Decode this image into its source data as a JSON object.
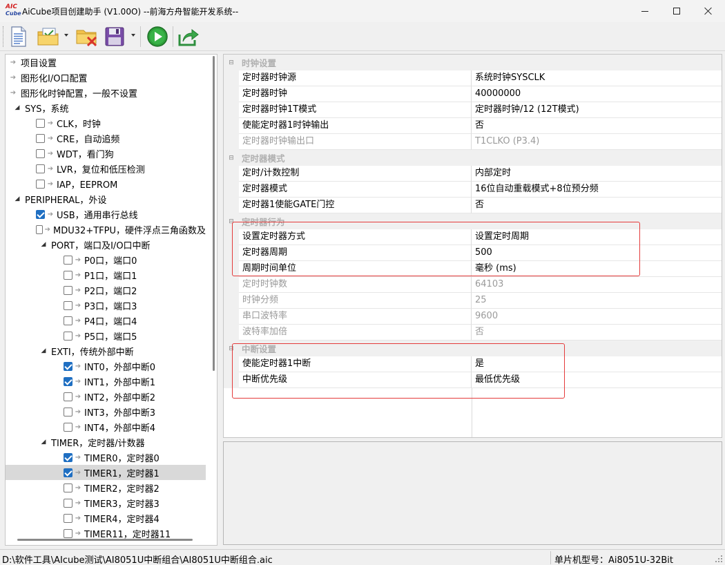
{
  "window": {
    "logo_top": "AIC",
    "logo_bottom": "Cube",
    "title": "AiCube项目创建助手 (V1.00O) --前海方舟智能开发系统--"
  },
  "toolbar": {
    "buttons": [
      {
        "name": "new-project",
        "icon": "new-document-icon"
      },
      {
        "name": "open-project",
        "icon": "open-folder-icon",
        "has_dropdown": true
      },
      {
        "name": "close-project",
        "icon": "close-folder-icon"
      },
      {
        "name": "save-project",
        "icon": "floppy-disk-icon",
        "has_dropdown": true
      },
      {
        "name": "run",
        "icon": "play-icon"
      },
      {
        "name": "export",
        "icon": "export-arrow-icon"
      }
    ]
  },
  "tree": {
    "items": [
      {
        "label": "项目设置",
        "kind": "leaf",
        "level": 0
      },
      {
        "label": "图形化I/O口配置",
        "kind": "leaf",
        "level": 0
      },
      {
        "label": "图形化时钟配置，一般不设置",
        "kind": "leaf",
        "level": 0
      },
      {
        "label": "SYS，系统",
        "kind": "group",
        "level": 0,
        "expanded": true
      },
      {
        "label": "CLK，时钟",
        "kind": "check",
        "level": 1,
        "checked": false
      },
      {
        "label": "CRE，自动追频",
        "kind": "check",
        "level": 1,
        "checked": false
      },
      {
        "label": "WDT，看门狗",
        "kind": "check",
        "level": 1,
        "checked": false
      },
      {
        "label": "LVR，复位和低压检测",
        "kind": "check",
        "level": 1,
        "checked": false
      },
      {
        "label": "IAP，EEPROM",
        "kind": "check",
        "level": 1,
        "checked": false
      },
      {
        "label": "PERIPHERAL，外设",
        "kind": "group",
        "level": 0,
        "expanded": true
      },
      {
        "label": "USB，通用串行总线",
        "kind": "check",
        "level": 1,
        "checked": true
      },
      {
        "label": "MDU32+TFPU，硬件浮点三角函数及",
        "kind": "check",
        "level": 1,
        "checked": false
      },
      {
        "label": "PORT，端口及I/O口中断",
        "kind": "group",
        "level": 1,
        "expanded": true
      },
      {
        "label": "P0口，端口0",
        "kind": "check",
        "level": 2,
        "checked": false
      },
      {
        "label": "P1口，端口1",
        "kind": "check",
        "level": 2,
        "checked": false
      },
      {
        "label": "P2口，端口2",
        "kind": "check",
        "level": 2,
        "checked": false
      },
      {
        "label": "P3口，端口3",
        "kind": "check",
        "level": 2,
        "checked": false
      },
      {
        "label": "P4口，端口4",
        "kind": "check",
        "level": 2,
        "checked": false
      },
      {
        "label": "P5口，端口5",
        "kind": "check",
        "level": 2,
        "checked": false
      },
      {
        "label": "EXTI，传统外部中断",
        "kind": "group",
        "level": 1,
        "expanded": true
      },
      {
        "label": "INT0，外部中断0",
        "kind": "check",
        "level": 2,
        "checked": true
      },
      {
        "label": "INT1，外部中断1",
        "kind": "check",
        "level": 2,
        "checked": true
      },
      {
        "label": "INT2，外部中断2",
        "kind": "check",
        "level": 2,
        "checked": false
      },
      {
        "label": "INT3，外部中断3",
        "kind": "check",
        "level": 2,
        "checked": false
      },
      {
        "label": "INT4，外部中断4",
        "kind": "check",
        "level": 2,
        "checked": false
      },
      {
        "label": "TIMER，定时器/计数器",
        "kind": "group",
        "level": 1,
        "expanded": true
      },
      {
        "label": "TIMER0，定时器0",
        "kind": "check",
        "level": 2,
        "checked": true
      },
      {
        "label": "TIMER1，定时器1",
        "kind": "check",
        "level": 2,
        "checked": true,
        "selected": true
      },
      {
        "label": "TIMER2，定时器2",
        "kind": "check",
        "level": 2,
        "checked": false
      },
      {
        "label": "TIMER3，定时器3",
        "kind": "check",
        "level": 2,
        "checked": false
      },
      {
        "label": "TIMER4，定时器4",
        "kind": "check",
        "level": 2,
        "checked": false
      },
      {
        "label": "TIMER11，定时器11",
        "kind": "check",
        "level": 2,
        "checked": false
      }
    ]
  },
  "properties": {
    "sections": [
      {
        "title": "时钟设置",
        "rows": [
          {
            "name": "定时器时钟源",
            "value": "系统时钟SYSCLK",
            "enabled": true
          },
          {
            "name": "定时器时钟",
            "value": "40000000",
            "enabled": true
          },
          {
            "name": "定时器时钟1T模式",
            "value": "定时器时钟/12 (12T模式)",
            "enabled": true
          },
          {
            "name": "使能定时器1时钟输出",
            "value": "否",
            "enabled": true
          },
          {
            "name": "定时器时钟输出口",
            "value": "T1CLKO (P3.4)",
            "enabled": false
          }
        ]
      },
      {
        "title": "定时器模式",
        "rows": [
          {
            "name": "定时/计数控制",
            "value": "内部定时",
            "enabled": true
          },
          {
            "name": "定时器模式",
            "value": "16位自动重载模式+8位预分频",
            "enabled": true
          },
          {
            "name": "定时器1使能GATE门控",
            "value": "否",
            "enabled": true
          }
        ]
      },
      {
        "title": "定时器行为",
        "rows": [
          {
            "name": "设置定时器方式",
            "value": "设置定时周期",
            "enabled": true
          },
          {
            "name": "定时器周期",
            "value": "500",
            "enabled": true
          },
          {
            "name": "周期时间单位",
            "value": "毫秒 (ms)",
            "enabled": true
          },
          {
            "name": "定时时钟数",
            "value": "64103",
            "enabled": false
          },
          {
            "name": "时钟分频",
            "value": "25",
            "enabled": false
          },
          {
            "name": "串口波特率",
            "value": "9600",
            "enabled": false
          },
          {
            "name": "波特率加倍",
            "value": "否",
            "enabled": false
          }
        ]
      },
      {
        "title": "中断设置",
        "rows": [
          {
            "name": "使能定时器1中断",
            "value": "是",
            "enabled": true
          },
          {
            "name": "中断优先级",
            "value": "最低优先级",
            "enabled": true
          }
        ]
      }
    ]
  },
  "highlight_color": "#e43a3a",
  "statusbar": {
    "path": "D:\\软件工具\\AIcube测试\\AI8051U中断组合\\AI8051U中断组合.aic",
    "chip": "单片机型号：Ai8051U-32Bit"
  }
}
